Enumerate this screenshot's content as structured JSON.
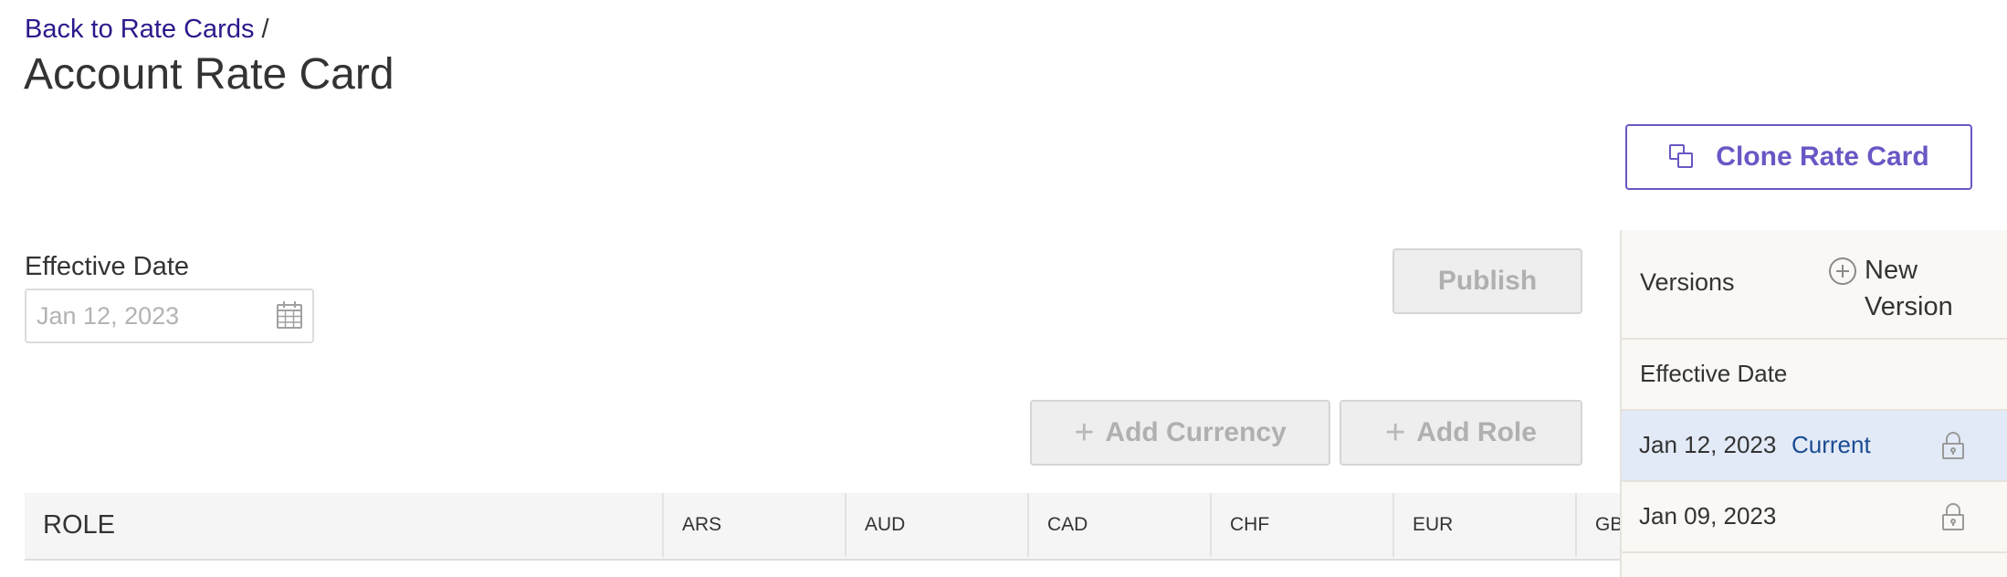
{
  "breadcrumb": {
    "back_link": "Back to Rate Cards",
    "separator": "/"
  },
  "page": {
    "title": "Account Rate Card"
  },
  "actions": {
    "clone_label": "Clone Rate Card",
    "publish_label": "Publish",
    "add_currency_label": "Add Currency",
    "add_role_label": "Add Role"
  },
  "effective_date": {
    "label": "Effective Date",
    "placeholder": "Jan 12, 2023",
    "icon": "calendar-icon"
  },
  "table": {
    "role_header": "ROLE",
    "currencies": [
      "ARS",
      "AUD",
      "CAD",
      "CHF",
      "EUR",
      "GBP"
    ]
  },
  "versions": {
    "title": "Versions",
    "new_label": "New Version",
    "column_header": "Effective Date",
    "rows": [
      {
        "date": "Jan 12, 2023",
        "status": "Current",
        "locked": true,
        "selected": true
      },
      {
        "date": "Jan 09, 2023",
        "status": "",
        "locked": true,
        "selected": false
      }
    ]
  },
  "colors": {
    "brand": "#6a57c5",
    "link": "#2a1a8c",
    "current": "#1a4c91",
    "selected_row": "#e3eaf7"
  }
}
